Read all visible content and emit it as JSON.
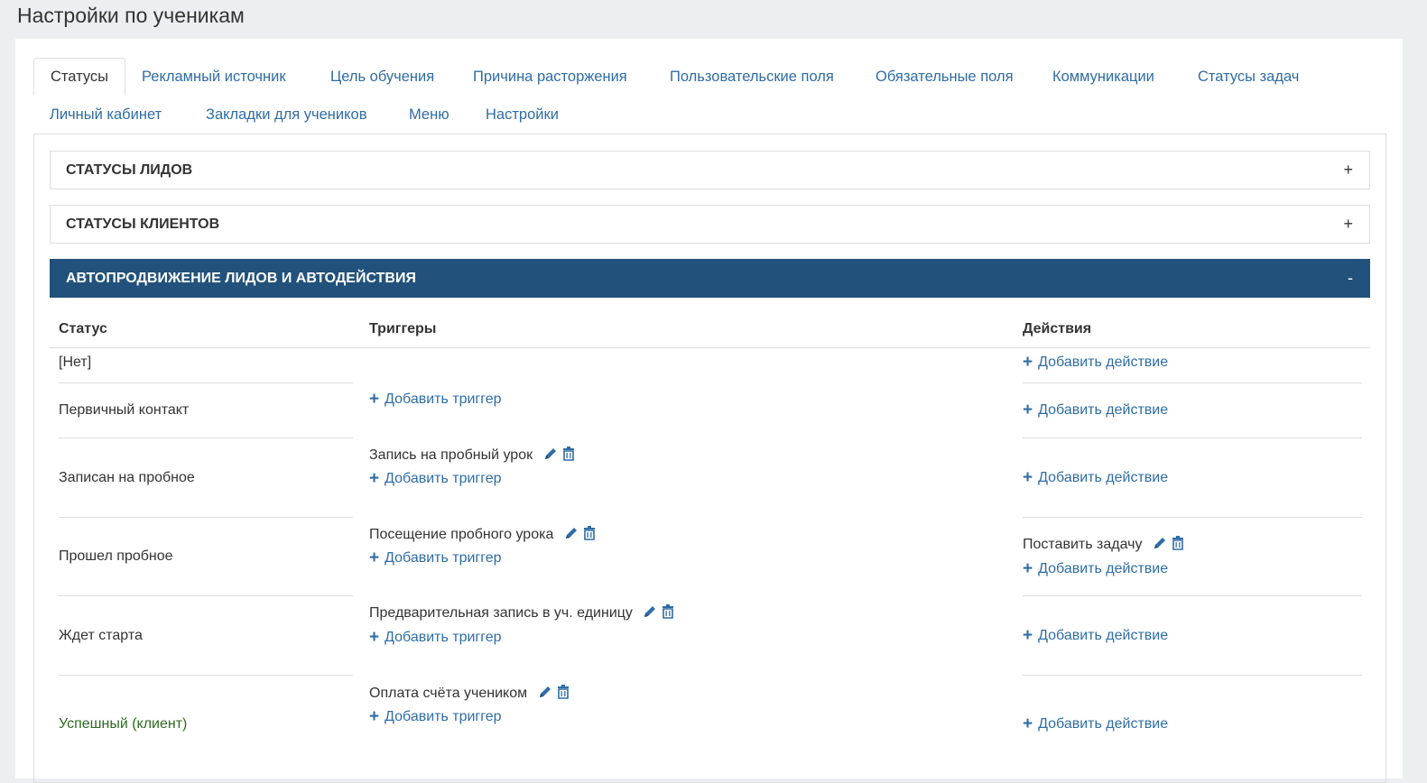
{
  "page": {
    "title": "Настройки по ученикам"
  },
  "tabs": [
    {
      "label": "Статусы"
    },
    {
      "label": "Рекламный источник"
    },
    {
      "label": "Цель обучения"
    },
    {
      "label": "Причина расторжения"
    },
    {
      "label": "Пользовательские поля"
    },
    {
      "label": "Обязательные поля"
    },
    {
      "label": "Коммуникации"
    },
    {
      "label": "Статусы задач"
    },
    {
      "label": "Личный кабинет"
    },
    {
      "label": "Закладки для учеников"
    },
    {
      "label": "Меню"
    },
    {
      "label": "Настройки"
    }
  ],
  "accordions": [
    {
      "title": "Статусы лидов",
      "toggle": "+"
    },
    {
      "title": "Статусы клиентов",
      "toggle": "+"
    },
    {
      "title": "Автопродвижение лидов и автодействия",
      "toggle": "-"
    }
  ],
  "table": {
    "headers": {
      "status": "Статус",
      "triggers": "Триггеры",
      "actions": "Действия"
    },
    "add_trigger": "Добавить триггер",
    "add_action": "Добавить действие",
    "rows": [
      {
        "status": "[Нет]",
        "trigger": "",
        "action": ""
      },
      {
        "status": "Первичный контакт",
        "trigger": "",
        "action": ""
      },
      {
        "status": "Записан на пробное",
        "trigger": "Запись на пробный урок",
        "action": ""
      },
      {
        "status": "Прошел пробное",
        "trigger": "Посещение пробного урока",
        "action": "Поставить задачу"
      },
      {
        "status": "Ждет старта",
        "trigger": "Предварительная запись в уч. единицу",
        "action": ""
      },
      {
        "status": "Успешный (клиент)",
        "trigger": "Оплата счёта учеником",
        "action": ""
      }
    ]
  },
  "colors": {
    "link": "#2f6da5",
    "accordion_active": "#22527b",
    "success_status": "#2d6b1f"
  },
  "icons": {
    "edit": "pencil-icon",
    "delete": "trash-icon",
    "add": "plus-icon"
  }
}
